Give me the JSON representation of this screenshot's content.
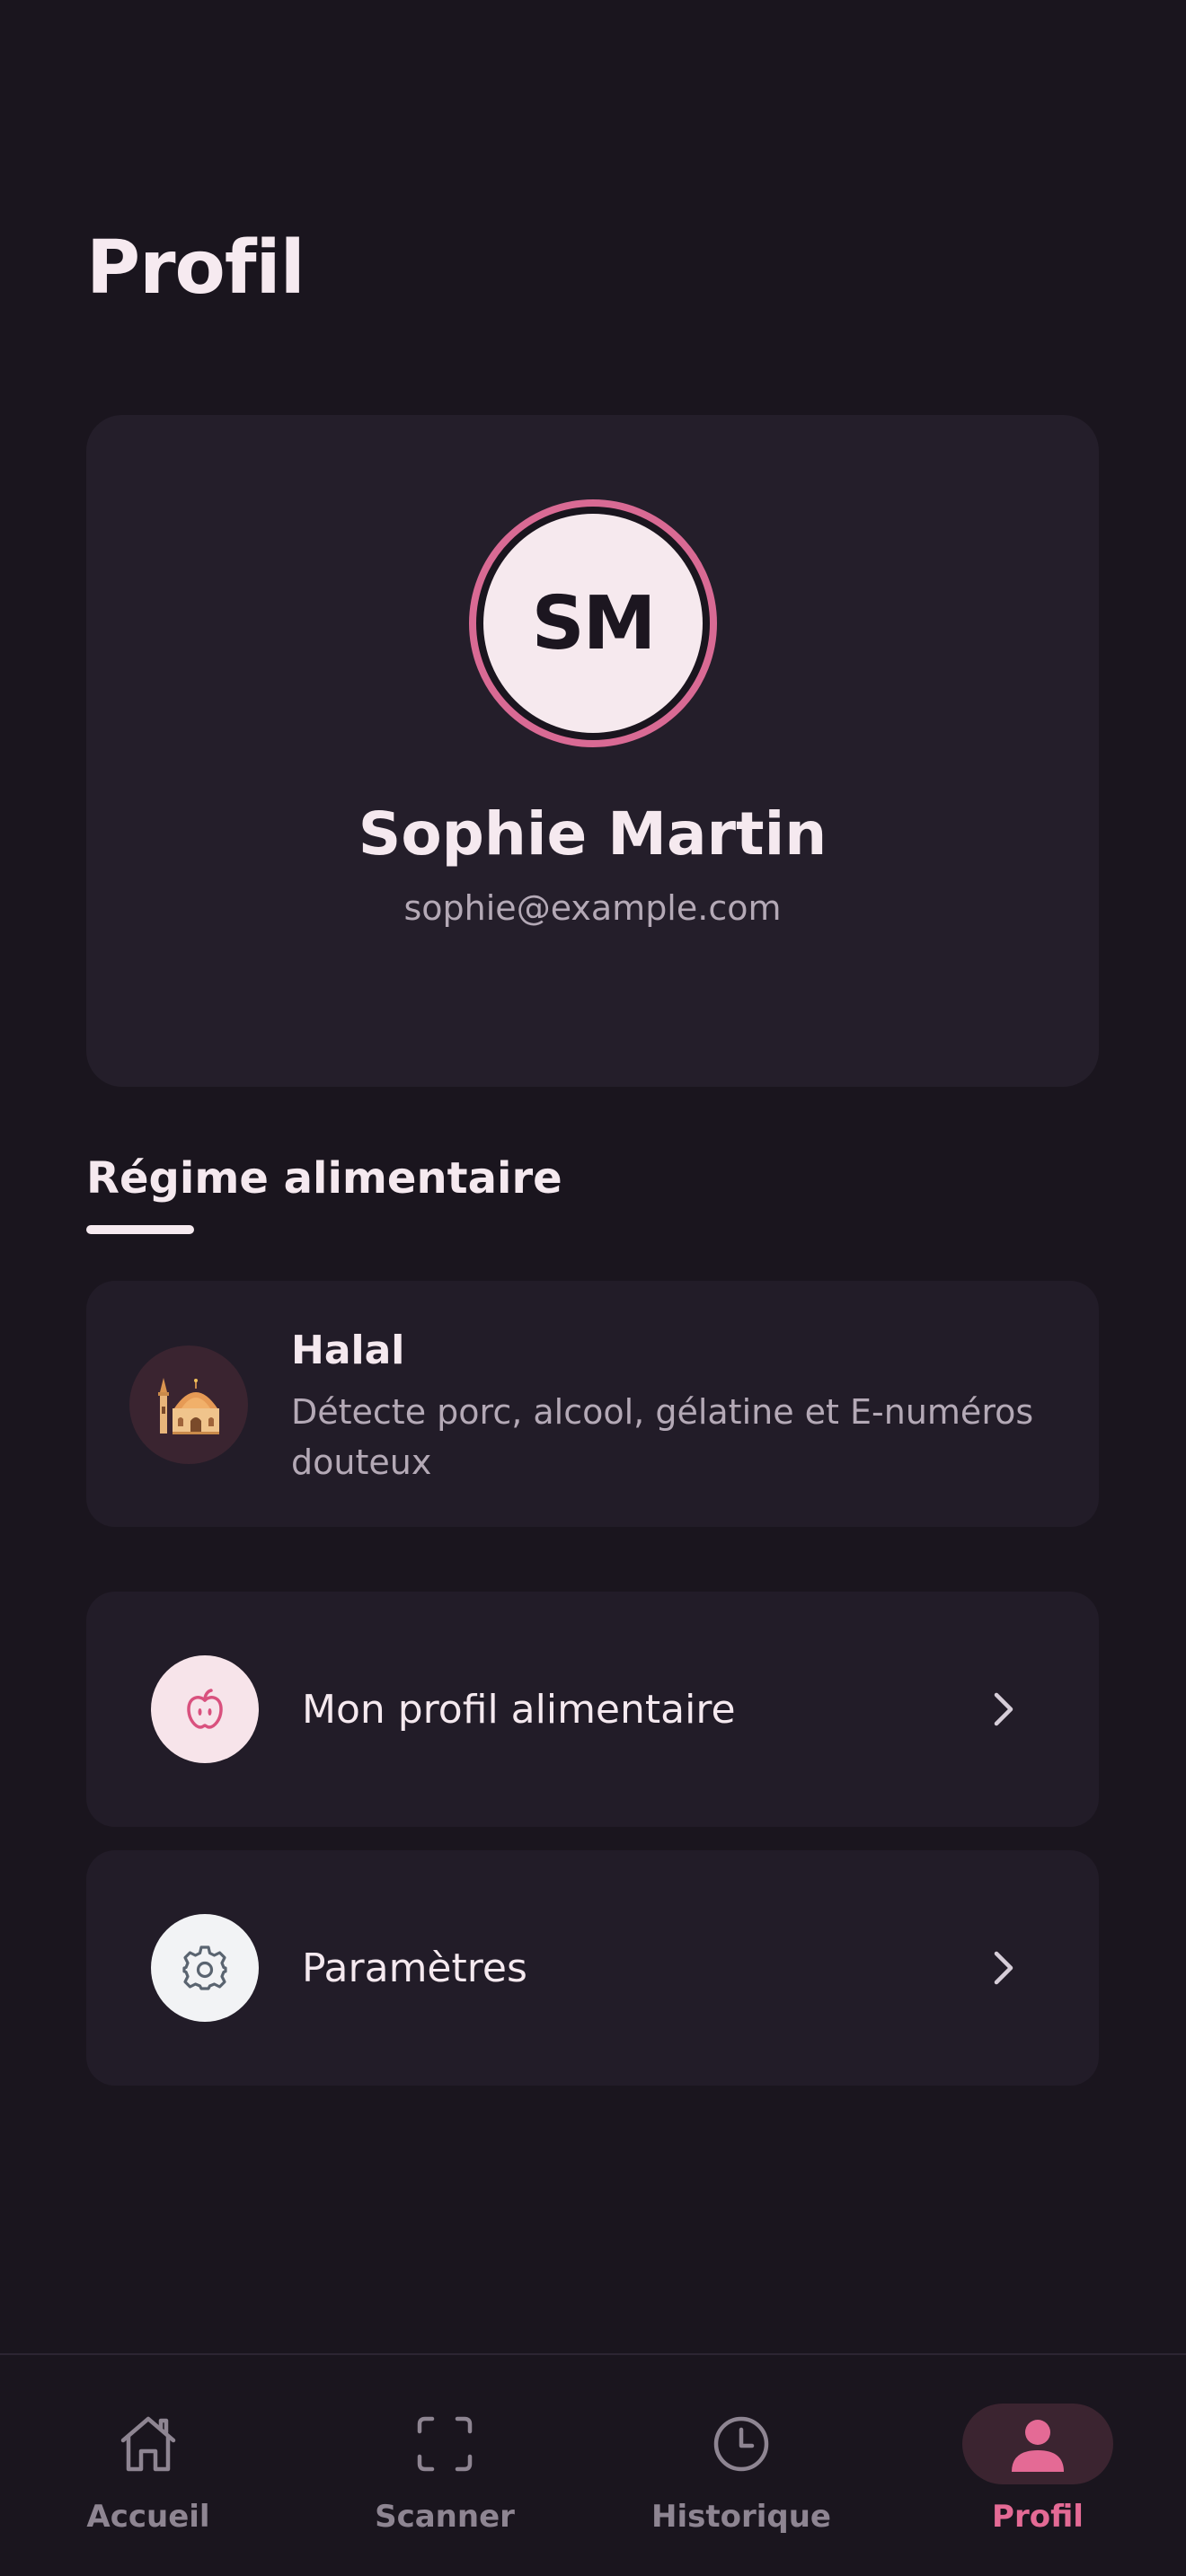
{
  "page": {
    "title": "Profil"
  },
  "profile": {
    "initials": "SM",
    "name": "Sophie Martin",
    "email": "sophie@example.com"
  },
  "diet_section": {
    "title": "Régime alimentaire",
    "diet": {
      "icon": "mosque-icon",
      "name": "Halal",
      "description": "Détecte porc, alcool, gélatine et E-numéros douteux"
    }
  },
  "menu": [
    {
      "label": "Mon profil alimentaire",
      "icon": "apple-icon",
      "icon_bg": "#f7e4ea",
      "icon_color": "#d9517e"
    },
    {
      "label": "Paramètres",
      "icon": "gear-icon",
      "icon_bg": "#f2f3f5",
      "icon_color": "#5a6470"
    }
  ],
  "bottom_nav": [
    {
      "label": "Accueil",
      "icon": "home-icon",
      "active": false
    },
    {
      "label": "Scanner",
      "icon": "scan-icon",
      "active": false
    },
    {
      "label": "Historique",
      "icon": "clock-icon",
      "active": false
    },
    {
      "label": "Profil",
      "icon": "person-icon",
      "active": true
    }
  ],
  "colors": {
    "background": "#1a151e",
    "card": "#241e2a",
    "accent": "#e46a95",
    "muted_text": "#b4a9b6"
  }
}
